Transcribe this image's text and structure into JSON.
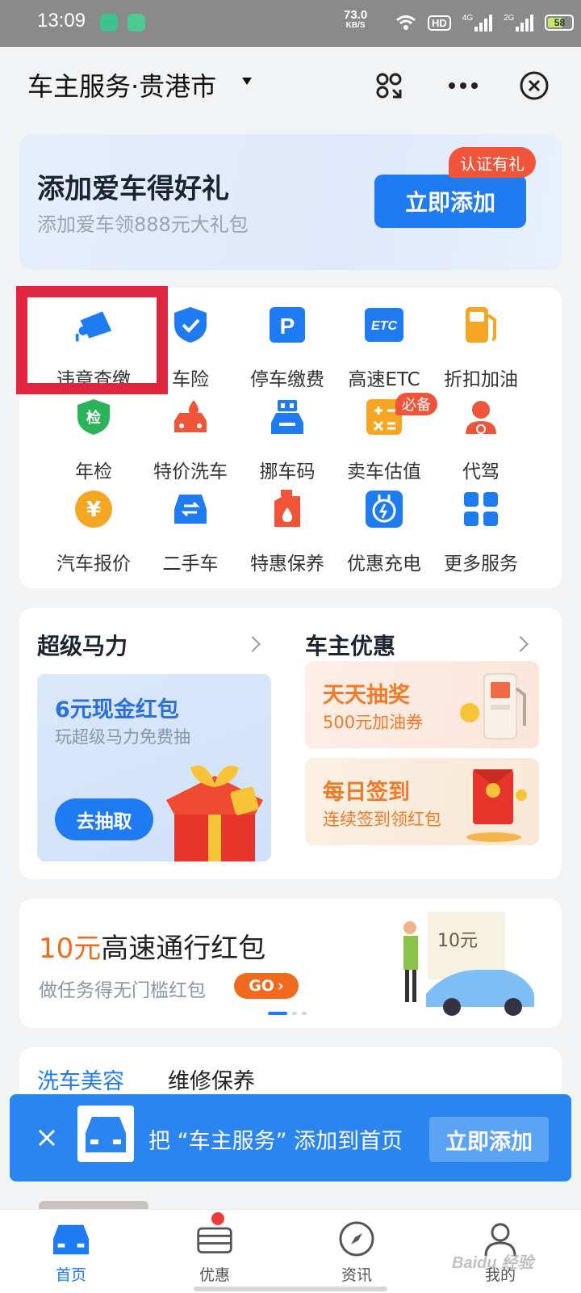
{
  "status_bar": {
    "time": "13:09",
    "net_speed_value": "73.0",
    "net_speed_unit": "KB/S",
    "hd": "HD",
    "signal_1": "4G",
    "signal_2": "2G",
    "battery": "58"
  },
  "header": {
    "title": "车主服务·贵港市"
  },
  "banner": {
    "title": "添加爱车得好礼",
    "subtitle": "添加爱车领888元大礼包",
    "button": "立即添加",
    "badge": "认证有礼"
  },
  "services": [
    {
      "label": "违章查缴",
      "icon": "camera-icon",
      "color": "#1f7bf2"
    },
    {
      "label": "车险",
      "icon": "shield-check-icon",
      "color": "#1f7bf2"
    },
    {
      "label": "停车缴费",
      "icon": "parking-icon",
      "color": "#1f7bf2"
    },
    {
      "label": "高速ETC",
      "icon": "etc-icon",
      "color": "#1f7bf2"
    },
    {
      "label": "折扣加油",
      "icon": "fuel-pump-icon",
      "color": "#f5a623"
    },
    {
      "label": "年检",
      "icon": "inspection-icon",
      "color": "#2bb35a",
      "glyph": "检"
    },
    {
      "label": "特价洗车",
      "icon": "car-wash-icon",
      "color": "#f0553a"
    },
    {
      "label": "挪车码",
      "icon": "qr-car-icon",
      "color": "#1f7bf2"
    },
    {
      "label": "卖车估值",
      "icon": "calculator-icon",
      "color": "#f5a623",
      "badge": "必备"
    },
    {
      "label": "代驾",
      "icon": "driver-icon",
      "color": "#f0553a"
    },
    {
      "label": "汽车报价",
      "icon": "yen-icon",
      "color": "#f5a623",
      "glyph": "¥"
    },
    {
      "label": "二手车",
      "icon": "used-car-icon",
      "color": "#1f7bf2"
    },
    {
      "label": "特惠保养",
      "icon": "oil-can-icon",
      "color": "#f0553a"
    },
    {
      "label": "优惠充电",
      "icon": "charging-icon",
      "color": "#1f7bf2"
    },
    {
      "label": "更多服务",
      "icon": "grid-icon",
      "color": "#1f7bf2"
    }
  ],
  "promo": {
    "left_title": "超级马力",
    "right_title": "车主优惠",
    "big_card": {
      "title": "6元现金红包",
      "subtitle": "玩超级马力免费抽",
      "button": "去抽取"
    },
    "card_lottery": {
      "title": "天天抽奖",
      "subtitle": "500元加油券"
    },
    "card_checkin": {
      "title": "每日签到",
      "subtitle": "连续签到领红包"
    }
  },
  "toll": {
    "amount": "10元",
    "title_rest": "高速通行红包",
    "subtitle": "做任务得无门槛红包",
    "go": "GO",
    "ticket": "10元"
  },
  "tabs": {
    "items": [
      "洗车美容",
      "维修保养"
    ],
    "active_index": 0
  },
  "add_bar": {
    "text": "把 “车主服务” 添加到首页",
    "button": "立即添加"
  },
  "bottom_nav": [
    {
      "label": "首页",
      "icon": "car-home-icon",
      "active": true
    },
    {
      "label": "优惠",
      "icon": "coupon-icon",
      "active": false
    },
    {
      "label": "资讯",
      "icon": "compass-icon",
      "active": false
    },
    {
      "label": "我的",
      "icon": "profile-icon",
      "active": false
    }
  ],
  "watermark": "Baidu 经验",
  "colors": {
    "accent": "#1f7bf2",
    "orange": "#f06a1e",
    "highlight_box": "#e02541"
  }
}
